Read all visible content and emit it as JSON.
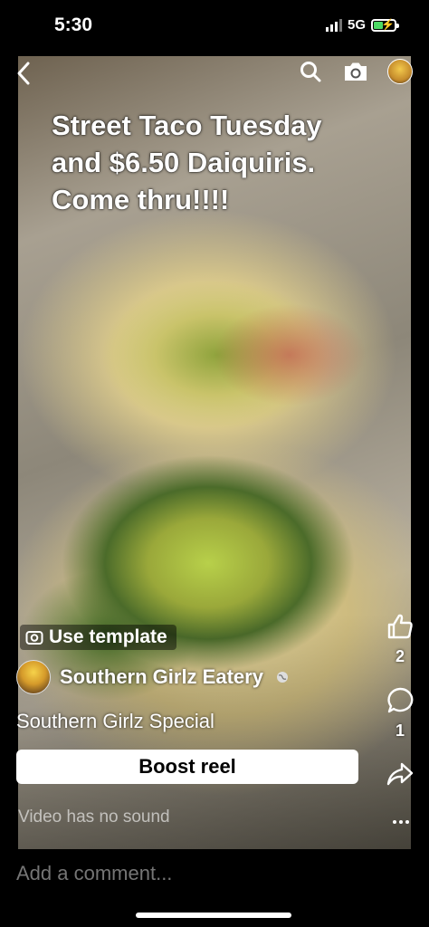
{
  "status": {
    "time": "5:30",
    "network": "5G"
  },
  "post": {
    "caption_lines": [
      "Street Taco Tuesday",
      "and $6.50 Daiquiris.",
      "Come thru!!!!"
    ],
    "use_template_label": "Use template",
    "author_name": "Southern Girlz Eatery",
    "reel_title": "Southern Girlz Special",
    "boost_label": "Boost reel",
    "sound_status": "Video has no sound"
  },
  "actions": {
    "likes": "2",
    "comments": "1"
  },
  "comment_bar": {
    "placeholder": "Add a comment..."
  },
  "icons": [
    "back-icon",
    "search-icon",
    "camera-icon",
    "like-icon",
    "comment-icon",
    "share-icon",
    "more-icon",
    "globe-icon"
  ]
}
